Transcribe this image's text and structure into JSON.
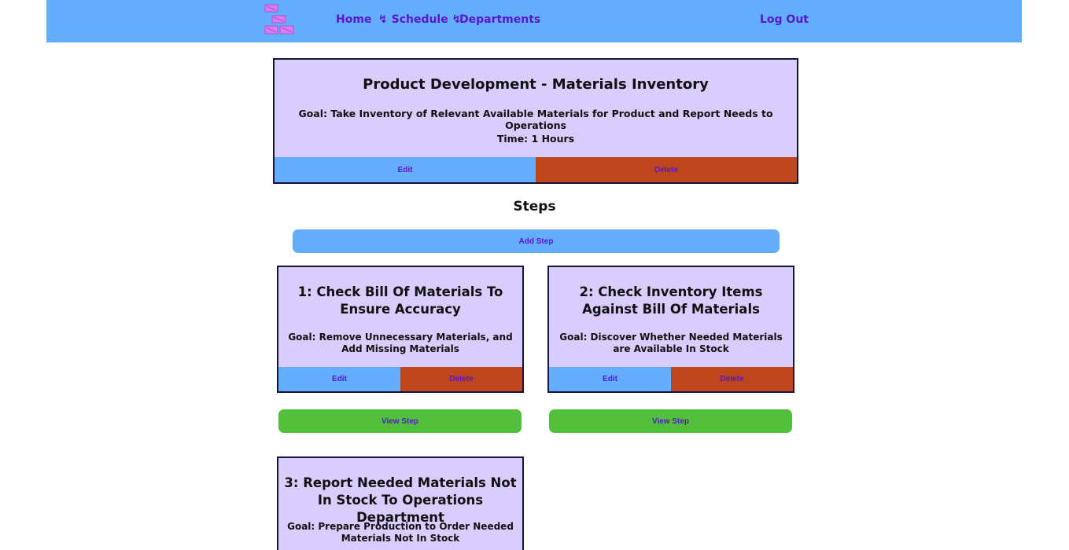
{
  "nav": {
    "home": "Home",
    "schedule": "↯ Schedule ↯",
    "departments": "Departments",
    "logout": "Log Out"
  },
  "task": {
    "title": "Product Development - Materials Inventory",
    "goal": "Goal: Take Inventory of Relevant Available Materials for Product and Report Needs to Operations",
    "time": "Time: 1 Hours",
    "edit_label": "Edit",
    "delete_label": "Delete"
  },
  "steps_heading": "Steps",
  "add_step_label": "Add Step",
  "steps": [
    {
      "title": "1: Check Bill Of Materials To Ensure Accuracy",
      "goal": "Goal: Remove Unnecessary Materials, and Add Missing Materials",
      "edit_label": "Edit",
      "delete_label": "Delete",
      "view_label": "View Step"
    },
    {
      "title": "2: Check Inventory Items Against Bill Of Materials",
      "goal": "Goal: Discover Whether Needed Materials are Available In Stock",
      "edit_label": "Edit",
      "delete_label": "Delete",
      "view_label": "View Step"
    },
    {
      "title": "3: Report Needed Materials Not In Stock To Operations Department",
      "goal": "Goal: Prepare Production to Order Needed Materials Not In Stock"
    }
  ],
  "colors": {
    "navbar": "#62adfc",
    "card": "#d8cdfc",
    "link": "#5b17c9",
    "edit": "#62adfc",
    "delete": "#bd461d",
    "view": "#52c03a",
    "logo": "#d97cf0"
  }
}
